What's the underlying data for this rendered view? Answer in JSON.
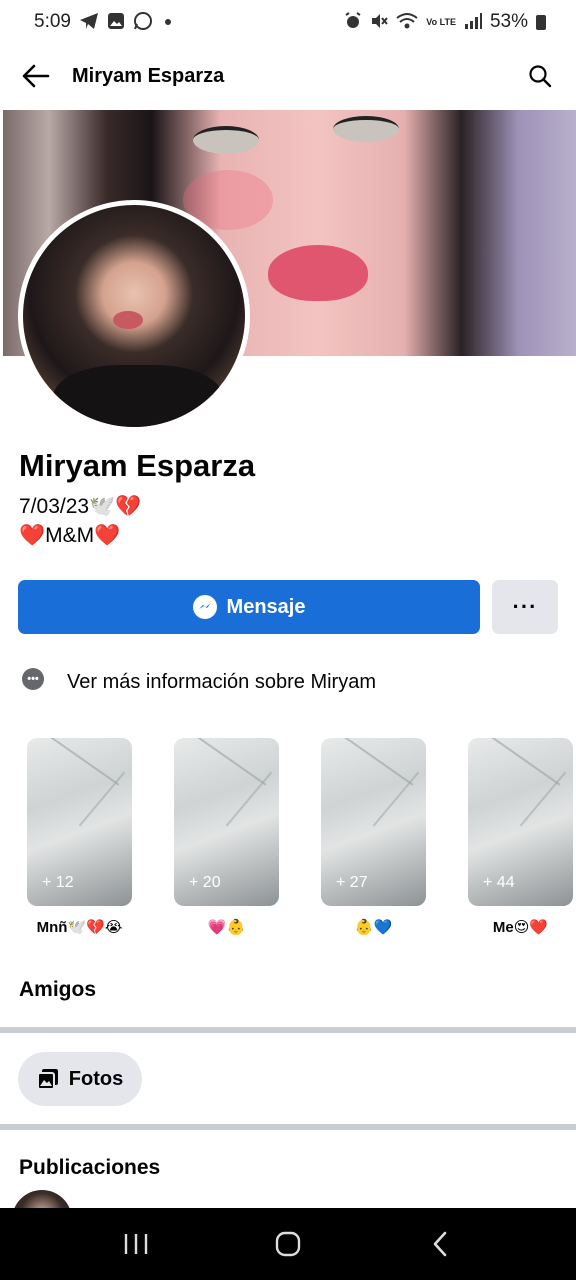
{
  "status_bar": {
    "time": "5:09",
    "battery": "53%",
    "network": "Vo LTE"
  },
  "header": {
    "title": "Miryam Esparza"
  },
  "profile": {
    "name": "Miryam Esparza",
    "bio_line1": "7/03/23🕊️💔",
    "bio_line2": "❤️M&M❤️"
  },
  "actions": {
    "message_label": "Mensaje",
    "more_label": "···"
  },
  "info": {
    "text": "Ver más información sobre Miryam"
  },
  "highlights": [
    {
      "count": "+ 12",
      "label": "Mnñ🕊️💔😭"
    },
    {
      "count": "+ 20",
      "label": "💗👶"
    },
    {
      "count": "+ 27",
      "label": "👶💙"
    },
    {
      "count": "+ 44",
      "label": "Me😍❤️"
    }
  ],
  "sections": {
    "friends": "Amigos",
    "photos": "Fotos",
    "posts": "Publicaciones"
  },
  "colors": {
    "accent": "#1a6ed8",
    "secondary_button": "#e4e6eb",
    "divider": "#c9ccd1"
  }
}
